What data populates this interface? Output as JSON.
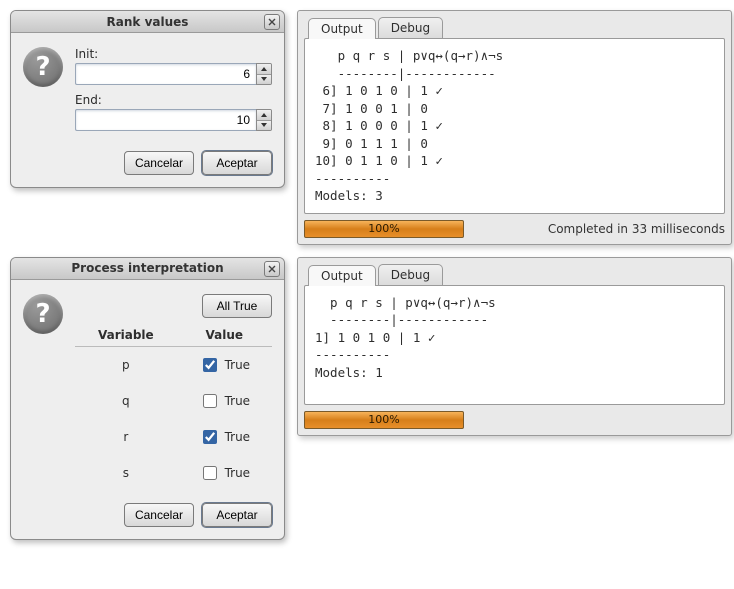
{
  "rank_dialog": {
    "title": "Rank values",
    "init_label": "Init:",
    "init_value": "6",
    "end_label": "End:",
    "end_value": "10",
    "cancel_label": "Cancelar",
    "accept_label": "Aceptar"
  },
  "proc_dialog": {
    "title": "Process interpretation",
    "alltrue_label": "All True",
    "col_variable": "Variable",
    "col_value": "Value",
    "rows": [
      {
        "name": "p",
        "checked": true,
        "text": "True"
      },
      {
        "name": "q",
        "checked": false,
        "text": "True"
      },
      {
        "name": "r",
        "checked": true,
        "text": "True"
      },
      {
        "name": "s",
        "checked": false,
        "text": "True"
      }
    ],
    "cancel_label": "Cancelar",
    "accept_label": "Aceptar"
  },
  "output_top": {
    "tabs": {
      "output": "Output",
      "debug": "Debug"
    },
    "text": "   p q r s | p∨q↔(q→r)∧¬s\n   --------|------------\n 6] 1 0 1 0 | 1 ✓\n 7] 1 0 0 1 | 0\n 8] 1 0 0 0 | 1 ✓\n 9] 0 1 1 1 | 0\n10] 0 1 1 0 | 1 ✓\n----------\nModels: 3",
    "progress": "100%",
    "completed": "Completed in 33 milliseconds"
  },
  "output_bottom": {
    "tabs": {
      "output": "Output",
      "debug": "Debug"
    },
    "text": "  p q r s | p∨q↔(q→r)∧¬s\n  --------|------------\n1] 1 0 1 0 | 1 ✓\n----------\nModels: 1",
    "progress": "100%"
  }
}
